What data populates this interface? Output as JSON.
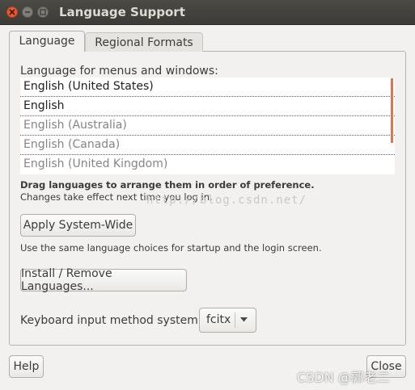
{
  "window": {
    "title": "Language Support"
  },
  "tabs": [
    {
      "label": "Language",
      "active": true
    },
    {
      "label": "Regional Formats",
      "active": false
    }
  ],
  "language_section": {
    "label": "Language for menus and windows:",
    "languages": [
      {
        "name": "English (United States)",
        "active": true
      },
      {
        "name": "English",
        "active": true
      },
      {
        "name": "English (Australia)",
        "active": false
      },
      {
        "name": "English (Canada)",
        "active": false
      },
      {
        "name": "English (United Kingdom)",
        "active": false
      }
    ],
    "hint_bold": "Drag languages to arrange them in order of preference.",
    "hint": "Changes take effect next time you log in."
  },
  "buttons": {
    "apply": "Apply System-Wide",
    "apply_description": "Use the same language choices for startup and the login screen.",
    "install": "Install / Remove Languages...",
    "help": "Help",
    "close": "Close"
  },
  "keyboard": {
    "label": "Keyboard input method system:",
    "value": "fcitx"
  },
  "overlays": {
    "watermark": "http://blog.csdn.net/",
    "csdn_mark": "CSDN @郭老二"
  },
  "colors": {
    "titlebar": "#3c3b37",
    "close_button": "#e85a2c",
    "scroll_accent": "#e2744c"
  }
}
